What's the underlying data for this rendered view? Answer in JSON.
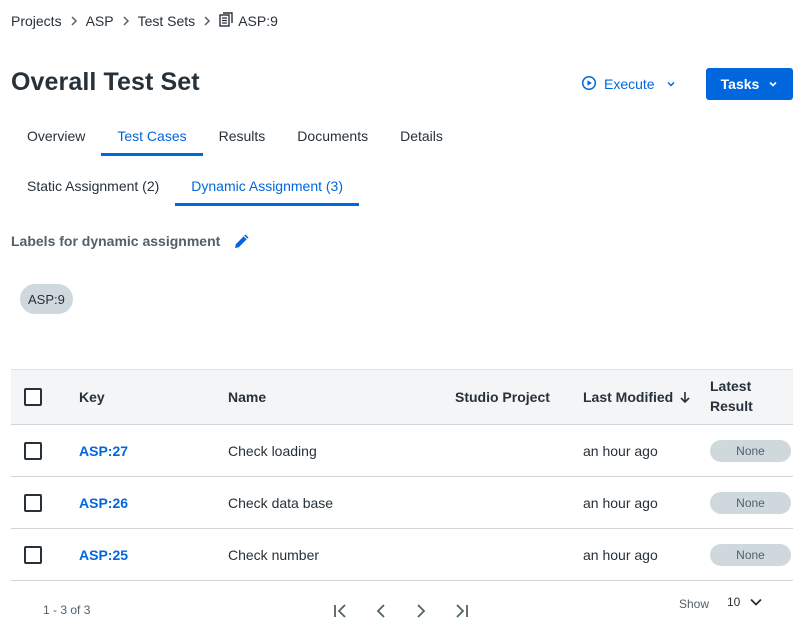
{
  "breadcrumb": {
    "items": [
      "Projects",
      "ASP",
      "Test Sets"
    ],
    "current": "ASP:9"
  },
  "page": {
    "title": "Overall Test Set"
  },
  "actions": {
    "execute_label": "Execute",
    "tasks_label": "Tasks"
  },
  "tabs": [
    {
      "label": "Overview",
      "active": false
    },
    {
      "label": "Test Cases",
      "active": true
    },
    {
      "label": "Results",
      "active": false
    },
    {
      "label": "Documents",
      "active": false
    },
    {
      "label": "Details",
      "active": false
    }
  ],
  "subtabs": [
    {
      "label": "Static Assignment (2)",
      "active": false
    },
    {
      "label": "Dynamic Assignment (3)",
      "active": true
    }
  ],
  "labels_section": {
    "heading": "Labels for dynamic assignment",
    "chips": [
      "ASP:9"
    ]
  },
  "table": {
    "columns": {
      "key": "Key",
      "name": "Name",
      "studio": "Studio Project",
      "modified": "Last Modified",
      "result_line1": "Latest",
      "result_line2": "Result"
    },
    "sort": {
      "column": "Last Modified",
      "direction": "descending"
    },
    "rows": [
      {
        "key": "ASP:27",
        "name": "Check loading",
        "studio": "",
        "modified": "an hour ago",
        "result": "None"
      },
      {
        "key": "ASP:26",
        "name": "Check data base",
        "studio": "",
        "modified": "an hour ago",
        "result": "None"
      },
      {
        "key": "ASP:25",
        "name": "Check number",
        "studio": "",
        "modified": "an hour ago",
        "result": "None"
      }
    ]
  },
  "pagination": {
    "range": "1 - 3 of 3",
    "show_label": "Show",
    "page_size": "10"
  },
  "icons": {
    "breadcrumb_current": "test-set-icon",
    "execute": "play-circle-icon",
    "execute_menu": "chevron-down-icon",
    "tasks_menu": "chevron-down-icon",
    "edit": "pencil-icon",
    "sort": "arrow-down-icon",
    "pager": [
      "first-page-icon",
      "previous-page-icon",
      "next-page-icon",
      "last-page-icon"
    ],
    "page_size": "chevron-down-icon"
  },
  "colors": {
    "accent": "#0067df",
    "text": "#273139",
    "muted": "#526069",
    "chip": "#cfd8dd"
  }
}
